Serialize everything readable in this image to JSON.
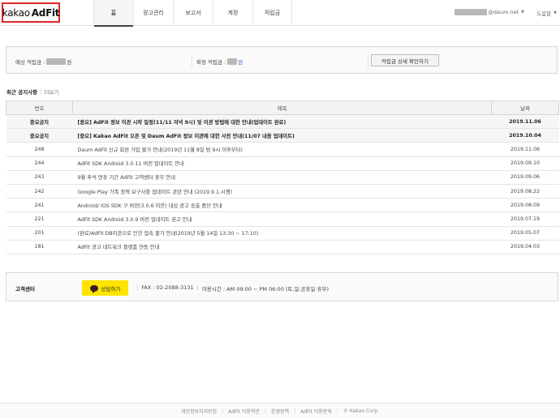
{
  "header": {
    "logo_kakao": "kakao",
    "logo_adfit": "AdFit",
    "nav": [
      "홈",
      "광고관리",
      "보고서",
      "계정",
      "적립금"
    ],
    "user_email_suffix": "@daum.net",
    "help": "도움말"
  },
  "earnings": {
    "expected_label": "예상 적립금 :",
    "expected_unit": "원",
    "confirmed_label": "확정 적립금 :",
    "confirmed_unit": "원",
    "detail_button": "적립금 상세 확인하기"
  },
  "notices": {
    "title": "최근 공지사항",
    "more": "더보기",
    "columns": [
      "번호",
      "제목",
      "날짜"
    ],
    "rows": [
      {
        "num": "중요공지",
        "subject": "[중요] AdFit 정보 이관 시작 일정(11/11 저녁 9시) 및 이관 방법에 대한 안내(업데이트 완료)",
        "date": "2019.11.06",
        "important": true
      },
      {
        "num": "중요공지",
        "subject": "[중요] Kakao AdFit 오픈 및 Daum AdFit 정보 이관에 대한 사전 안내(11/07 내용 업데이트)",
        "date": "2019.10.04",
        "important": true
      },
      {
        "num": "248",
        "subject": "Daum AdFit 신규 회원 가입 불가 안내(2019년 11월 8일 밤 9시 이후부터)",
        "date": "2019.11.06",
        "important": false
      },
      {
        "num": "244",
        "subject": "AdFit SDK Android 3.0.11 버전 업데이트 안내",
        "date": "2019.09.10",
        "important": false
      },
      {
        "num": "243",
        "subject": "9월 추석 연휴 기간 AdFit 고객센터 휴무 안내",
        "date": "2019.09.06",
        "important": false
      },
      {
        "num": "242",
        "subject": "Google Play 가족 정책 요구사항 업데이트 관련 안내 (2019.9.1.시행)",
        "date": "2019.08.22",
        "important": false
      },
      {
        "num": "241",
        "subject": "Android/ IOS SDK 구 버전(3.0.6 미만) 대상 광고 송출 중단 안내",
        "date": "2019.08.09",
        "important": false
      },
      {
        "num": "221",
        "subject": "AdFit SDK Android 3.0.9 버전 업데이트 권고 안내",
        "date": "2019.07.19",
        "important": false
      },
      {
        "num": "201",
        "subject": "(완료)AdFit DB이관으로 인한 접속 불가 안내(2019년 5월 14일 13:30 ~ 17:10)",
        "date": "2019.05.07",
        "important": false
      },
      {
        "num": "181",
        "subject": "AdFit 광고 네트워크 플랫폼 연동 안내",
        "date": "2019.04.03",
        "important": false
      }
    ]
  },
  "customer_center": {
    "title": "고객센터",
    "talk_button": "상담하기",
    "fax": "FAX : 02-2088-3131",
    "hours": "이용시간 : AM 09:00 ~ PM 06:00 (토,일,공휴일 휴무)"
  },
  "footer": {
    "links": [
      "개인정보처리방침",
      "AdFit 이용약관",
      "운영정책",
      "AdFit 이용문의"
    ],
    "copyright": "© Kakao Corp."
  }
}
